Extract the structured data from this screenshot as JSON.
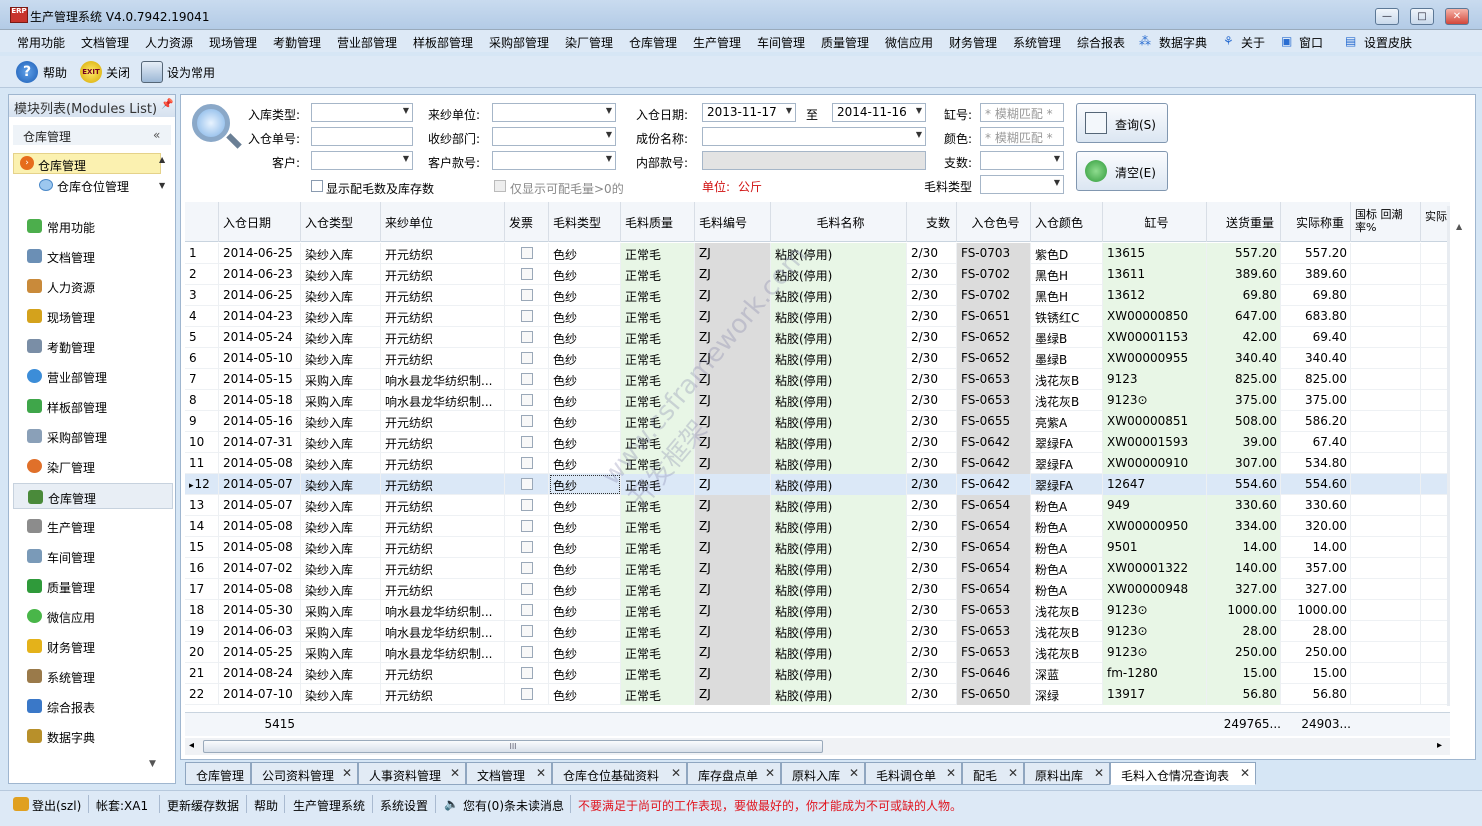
{
  "window": {
    "title": "生产管理系统 V4.0.7942.19041",
    "icon_text": "ERP",
    "min": "—",
    "max": "□",
    "close": "✕"
  },
  "menu": [
    "常用功能",
    "文档管理",
    "人力资源",
    "现场管理",
    "考勤管理",
    "营业部管理",
    "样板部管理",
    "采购部管理",
    "染厂管理",
    "仓库管理",
    "生产管理",
    "车间管理",
    "质量管理",
    "微信应用",
    "财务管理",
    "系统管理",
    "综合报表",
    "数据字典",
    "关于",
    "窗口",
    "设置皮肤"
  ],
  "toolbar": {
    "help": "帮助",
    "close": "关闭",
    "favorite": "设为常用"
  },
  "sidebar": {
    "title": "模块列表(Modules List)",
    "pin": "📌",
    "group": "仓库管理",
    "collapse": "«",
    "sub": [
      "仓库管理",
      "仓库仓位管理"
    ],
    "items": [
      "常用功能",
      "文档管理",
      "人力资源",
      "现场管理",
      "考勤管理",
      "营业部管理",
      "样板部管理",
      "采购部管理",
      "染厂管理",
      "仓库管理",
      "生产管理",
      "车间管理",
      "质量管理",
      "微信应用",
      "财务管理",
      "系统管理",
      "综合报表",
      "数据字典"
    ],
    "down_arrow": "▼"
  },
  "filters": {
    "in_type": "入库类型:",
    "in_no": "入仓单号:",
    "customer": "客户:",
    "from_unit": "来纱单位:",
    "recv_dept": "收纱部门:",
    "cust_no": "客户款号:",
    "in_date": "入仓日期:",
    "date_from": "2013-11-17",
    "to": "至",
    "date_to": "2014-11-16",
    "composition": "成份名称:",
    "inner_no": "内部款号:",
    "unit_label": "单位:",
    "unit_value": "公斤",
    "vat_no": "缸号:",
    "color": "颜色:",
    "count": "支数:",
    "yarn_type": "毛料类型",
    "fuzzy": "* 模糊匹配 *",
    "show_check": "显示配毛数及库存数",
    "only_check": "仅显示可配毛量>0的",
    "query": "查询(S)",
    "clear": "清空(E)"
  },
  "grid": {
    "headers": [
      "入仓日期",
      "入仓类型",
      "来纱单位",
      "发票",
      "毛料类型",
      "毛料质量",
      "毛料编号",
      "毛料名称",
      "支数",
      "入仓色号",
      "入仓颜色",
      "缸号",
      "送货重量",
      "实际称重",
      "国标 回潮率%",
      "实际潮"
    ],
    "rows": [
      [
        "1",
        "2014-06-25",
        "染纱入库",
        "开元纺织",
        "色纱",
        "正常毛",
        "ZJ",
        "粘胶(停用)",
        "2/30",
        "FS-0703",
        "紫色D",
        "13615",
        "557.20",
        "557.20"
      ],
      [
        "2",
        "2014-06-23",
        "染纱入库",
        "开元纺织",
        "色纱",
        "正常毛",
        "ZJ",
        "粘胶(停用)",
        "2/30",
        "FS-0702",
        "黑色H",
        "13611",
        "389.60",
        "389.60"
      ],
      [
        "3",
        "2014-06-25",
        "染纱入库",
        "开元纺织",
        "色纱",
        "正常毛",
        "ZJ",
        "粘胶(停用)",
        "2/30",
        "FS-0702",
        "黑色H",
        "13612",
        "69.80",
        "69.80"
      ],
      [
        "4",
        "2014-04-23",
        "染纱入库",
        "开元纺织",
        "色纱",
        "正常毛",
        "ZJ",
        "粘胶(停用)",
        "2/30",
        "FS-0651",
        "铁锈红C",
        "XW00000850",
        "647.00",
        "683.80"
      ],
      [
        "5",
        "2014-05-24",
        "染纱入库",
        "开元纺织",
        "色纱",
        "正常毛",
        "ZJ",
        "粘胶(停用)",
        "2/30",
        "FS-0652",
        "墨绿B",
        "XW00001153",
        "42.00",
        "69.40"
      ],
      [
        "6",
        "2014-05-10",
        "染纱入库",
        "开元纺织",
        "色纱",
        "正常毛",
        "ZJ",
        "粘胶(停用)",
        "2/30",
        "FS-0652",
        "墨绿B",
        "XW00000955",
        "340.40",
        "340.40"
      ],
      [
        "7",
        "2014-05-15",
        "采购入库",
        "响水县龙华纺织制...",
        "色纱",
        "正常毛",
        "ZJ",
        "粘胶(停用)",
        "2/30",
        "FS-0653",
        "浅花灰B",
        "9123",
        "825.00",
        "825.00"
      ],
      [
        "8",
        "2014-05-18",
        "采购入库",
        "响水县龙华纺织制...",
        "色纱",
        "正常毛",
        "ZJ",
        "粘胶(停用)",
        "2/30",
        "FS-0653",
        "浅花灰B",
        "9123⊙",
        "375.00",
        "375.00"
      ],
      [
        "9",
        "2014-05-16",
        "染纱入库",
        "开元纺织",
        "色纱",
        "正常毛",
        "ZJ",
        "粘胶(停用)",
        "2/30",
        "FS-0655",
        "亮紫A",
        "XW00000851",
        "508.00",
        "586.20"
      ],
      [
        "10",
        "2014-07-31",
        "染纱入库",
        "开元纺织",
        "色纱",
        "正常毛",
        "ZJ",
        "粘胶(停用)",
        "2/30",
        "FS-0642",
        "翠绿FA",
        "XW00001593",
        "39.00",
        "67.40"
      ],
      [
        "11",
        "2014-05-08",
        "染纱入库",
        "开元纺织",
        "色纱",
        "正常毛",
        "ZJ",
        "粘胶(停用)",
        "2/30",
        "FS-0642",
        "翠绿FA",
        "XW00000910",
        "307.00",
        "534.80"
      ],
      [
        "12",
        "2014-05-07",
        "染纱入库",
        "开元纺织",
        "色纱",
        "正常毛",
        "ZJ",
        "粘胶(停用)",
        "2/30",
        "FS-0642",
        "翠绿FA",
        "12647",
        "554.60",
        "554.60"
      ],
      [
        "13",
        "2014-05-07",
        "染纱入库",
        "开元纺织",
        "色纱",
        "正常毛",
        "ZJ",
        "粘胶(停用)",
        "2/30",
        "FS-0654",
        "粉色A",
        "949",
        "330.60",
        "330.60"
      ],
      [
        "14",
        "2014-05-08",
        "染纱入库",
        "开元纺织",
        "色纱",
        "正常毛",
        "ZJ",
        "粘胶(停用)",
        "2/30",
        "FS-0654",
        "粉色A",
        "XW00000950",
        "334.00",
        "320.00"
      ],
      [
        "15",
        "2014-05-08",
        "染纱入库",
        "开元纺织",
        "色纱",
        "正常毛",
        "ZJ",
        "粘胶(停用)",
        "2/30",
        "FS-0654",
        "粉色A",
        "9501",
        "14.00",
        "14.00"
      ],
      [
        "16",
        "2014-07-02",
        "染纱入库",
        "开元纺织",
        "色纱",
        "正常毛",
        "ZJ",
        "粘胶(停用)",
        "2/30",
        "FS-0654",
        "粉色A",
        "XW00001322",
        "140.00",
        "357.00"
      ],
      [
        "17",
        "2014-05-08",
        "染纱入库",
        "开元纺织",
        "色纱",
        "正常毛",
        "ZJ",
        "粘胶(停用)",
        "2/30",
        "FS-0654",
        "粉色A",
        "XW00000948",
        "327.00",
        "327.00"
      ],
      [
        "18",
        "2014-05-30",
        "采购入库",
        "响水县龙华纺织制...",
        "色纱",
        "正常毛",
        "ZJ",
        "粘胶(停用)",
        "2/30",
        "FS-0653",
        "浅花灰B",
        "9123⊙",
        "1000.00",
        "1000.00"
      ],
      [
        "19",
        "2014-06-03",
        "采购入库",
        "响水县龙华纺织制...",
        "色纱",
        "正常毛",
        "ZJ",
        "粘胶(停用)",
        "2/30",
        "FS-0653",
        "浅花灰B",
        "9123⊙",
        "28.00",
        "28.00"
      ],
      [
        "20",
        "2014-05-25",
        "采购入库",
        "响水县龙华纺织制...",
        "色纱",
        "正常毛",
        "ZJ",
        "粘胶(停用)",
        "2/30",
        "FS-0653",
        "浅花灰B",
        "9123⊙",
        "250.00",
        "250.00"
      ],
      [
        "21",
        "2014-08-24",
        "染纱入库",
        "开元纺织",
        "色纱",
        "正常毛",
        "ZJ",
        "粘胶(停用)",
        "2/30",
        "FS-0646",
        "深蓝",
        "fm-1280",
        "15.00",
        "15.00"
      ],
      [
        "22",
        "2014-07-10",
        "染纱入库",
        "开元纺织",
        "色纱",
        "正常毛",
        "ZJ",
        "粘胶(停用)",
        "2/30",
        "FS-0650",
        "深绿",
        "13917",
        "56.80",
        "56.80"
      ]
    ],
    "selected_row": "12",
    "selected_marker": "▸",
    "footer": {
      "count": "5415",
      "sum1": "249765...",
      "sum2": "24903..."
    },
    "scroll": {
      "left": "◂",
      "right": "▸",
      "grip": "III",
      "up": "▲"
    }
  },
  "tabs": [
    "仓库管理",
    "公司资料管理",
    "人事资料管理",
    "文档管理",
    "仓库仓位基础资料",
    "库存盘点单",
    "原料入库",
    "毛料调仓单",
    "配毛",
    "原料出库",
    "毛料入仓情况查询表"
  ],
  "tab_close": "✕",
  "status": {
    "logout": "登出(szl)",
    "account": "帐套:XA1",
    "refresh": "更新缓存数据",
    "help": "帮助",
    "system": "生产管理系统",
    "settings": "系统设置",
    "messages": "您有(0)条未读消息",
    "motto": "不要满足于尚可的工作表现，要做最好的，你才能成为不可或缺的人物。"
  },
  "colors": {
    "motto": "#e0141e",
    "unit": "#d01010",
    "accent": "#2b6ed1"
  }
}
